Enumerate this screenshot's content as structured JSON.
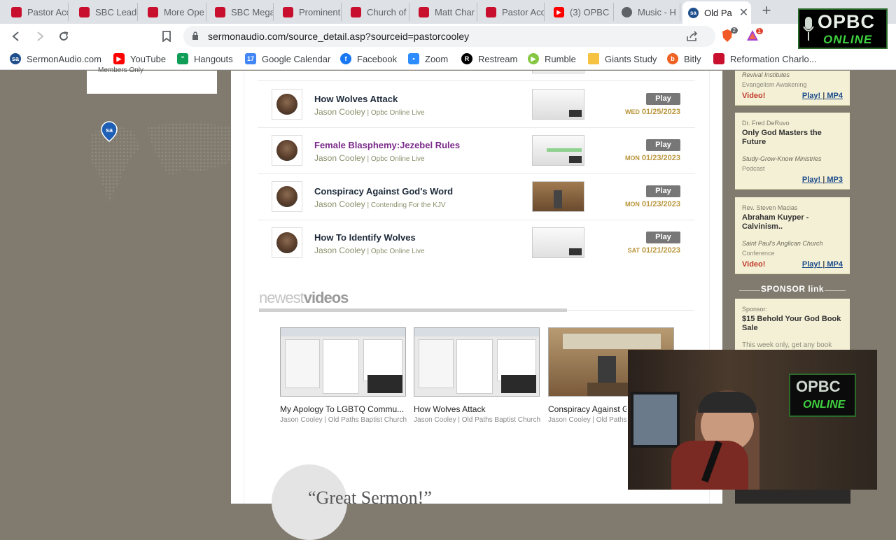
{
  "browser": {
    "tabs": [
      {
        "label": "Pastor Acc",
        "favicon": "sa-icon"
      },
      {
        "label": "SBC Leade",
        "favicon": "sa-icon"
      },
      {
        "label": "More Ope",
        "favicon": "sa-icon"
      },
      {
        "label": "SBC Mega",
        "favicon": "sa-icon"
      },
      {
        "label": "Prominent",
        "favicon": "sa-icon"
      },
      {
        "label": "Church of",
        "favicon": "sa-icon"
      },
      {
        "label": "Matt Char",
        "favicon": "sa-icon"
      },
      {
        "label": "Pastor Acc",
        "favicon": "sa-icon"
      },
      {
        "label": "(3) OPBC",
        "favicon": "youtube-icon"
      },
      {
        "label": "Music - H",
        "favicon": "globe-icon"
      },
      {
        "label": "Old Pa",
        "favicon": "sa-icon"
      }
    ],
    "url": "sermonaudio.com/source_detail.asp?sourceid=pastorcooley",
    "brave_badge": "2",
    "rewards_badge": "1",
    "bookmarks": [
      {
        "label": "SermonAudio.com",
        "icon": "sa"
      },
      {
        "label": "YouTube",
        "icon": "yt"
      },
      {
        "label": "Hangouts",
        "icon": "hangouts"
      },
      {
        "label": "Google Calendar",
        "icon": "cal",
        "icon_text": "17"
      },
      {
        "label": "Facebook",
        "icon": "fb"
      },
      {
        "label": "Zoom",
        "icon": "zoom"
      },
      {
        "label": "Restream",
        "icon": "restream"
      },
      {
        "label": "Rumble",
        "icon": "rumble"
      },
      {
        "label": "Giants Study",
        "icon": "folder"
      },
      {
        "label": "Bitly",
        "icon": "bitly"
      },
      {
        "label": "Reformation Charlo...",
        "icon": "sa"
      }
    ]
  },
  "left_panel": {
    "clipped_text": "Members Only",
    "map_pin_text": "sa"
  },
  "sermons": [
    {
      "title": "How Wolves Attack",
      "author": "Jason Cooley",
      "series": "Opbc Online Live",
      "day": "WED",
      "date": "01/25/2023",
      "play": "Play",
      "visited": false
    },
    {
      "title": "Female Blasphemy:Jezebel Rules",
      "author": "Jason Cooley",
      "series": "Opbc Online Live",
      "day": "MON",
      "date": "01/23/2023",
      "play": "Play",
      "visited": true
    },
    {
      "title": "Conspiracy Against God's Word",
      "author": "Jason Cooley",
      "series": "Contending For the KJV",
      "day": "MON",
      "date": "01/23/2023",
      "play": "Play",
      "visited": false
    },
    {
      "title": "How To Identify Wolves",
      "author": "Jason Cooley",
      "series": "Opbc Online Live",
      "day": "SAT",
      "date": "01/21/2023",
      "play": "Play",
      "visited": false
    }
  ],
  "newest_videos": {
    "heading_light": "newest",
    "heading_bold": "videos",
    "items": [
      {
        "title": "My Apology To LGBTQ Commu...",
        "sub": "Jason Cooley | Old Paths Baptist Church"
      },
      {
        "title": "How Wolves Attack",
        "sub": "Jason Cooley | Old Paths Baptist Church"
      },
      {
        "title": "Conspiracy Against G",
        "sub": "Jason Cooley | Old Paths B"
      }
    ]
  },
  "quote": "“Great Sermon!”",
  "sidebar": {
    "cards": [
      {
        "speaker": "",
        "title": "",
        "org": "Revival Institutes",
        "kind": "Evangelism Awakening",
        "video": "Video!",
        "play": "Play!",
        "fmt": "MP4"
      },
      {
        "speaker": "Dr. Fred DeRuvo",
        "title": "Only God Masters the Future",
        "org": "Study-Grow-Know Ministries",
        "kind": "Podcast",
        "video": "",
        "play": "Play!",
        "fmt": "MP3"
      },
      {
        "speaker": "Rev. Steven Macias",
        "title": "Abraham Kuyper - Calvinism..",
        "org": "Saint Paul's Anglican Church",
        "kind": "Conference",
        "video": "Video!",
        "play": "Play!",
        "fmt": "MP4"
      }
    ],
    "sponsor_heading": "SPONSOR link",
    "sponsor": {
      "label": "Sponsor:",
      "title": "$15 Behold Your God Book Sale",
      "text": "This week only, get any book"
    }
  },
  "overlay_logo": {
    "line1": "OPBC",
    "line2": "ONLINE"
  },
  "webcam_logo": {
    "line1": "OPBC",
    "line2": "ONLINE"
  },
  "colors": {
    "accent_gold": "#b8953a",
    "visited_link": "#7a2a8a",
    "play_button": "#777777",
    "page_bg": "#807b6e"
  }
}
